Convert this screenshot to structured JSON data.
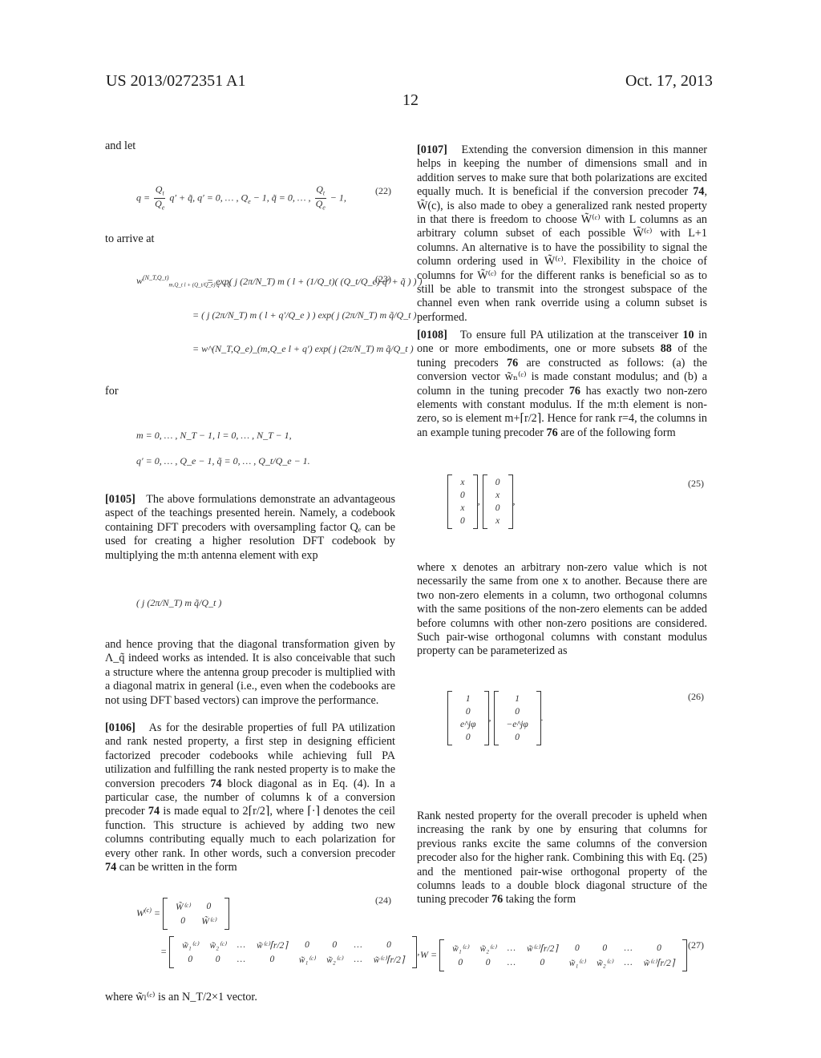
{
  "header": {
    "patent_number": "US 2013/0272351 A1",
    "page_number": "12",
    "date": "Oct. 17, 2013"
  },
  "left_column": {
    "intro_and_let": "and let",
    "eq22": {
      "number": "(22)",
      "lhs": "q =",
      "frac_num": "Q",
      "frac_num_sub": "t",
      "frac_den": "Q",
      "frac_den_sub": "e",
      "middle": "q′ + q̃, q′ = 0, … , Q",
      "middle_sub": "e",
      "middle2": " − 1, q̃ = 0, … ,",
      "tail": "− 1,"
    },
    "to_arrive_at": "to arrive at",
    "eq23": {
      "number": "(23)",
      "line1_lhs": "w",
      "line1_lhs_sup": "(N_T,Q_t)",
      "line1_lhs_sub": "m,Q_t l + (Q_t/Q_e) q′ + q̃",
      "line1_rhs": "= exp( j (2π/N_T) m ( l + (1/Q_t)( (Q_t/Q_e) q′ + q̃ ) ) )",
      "line2_rhs": "= ( j (2π/N_T) m ( l + q′/Q_e ) ) exp( j (2π/N_T) m q̃/Q_t )",
      "line3_rhs": "= w^(N_T,Q_e)_(m,Q_e l + q′) exp( j (2π/N_T) m q̃/Q_t )"
    },
    "for": "for",
    "ranges": {
      "line1": "m = 0, … , N_T − 1, l = 0, … , N_T − 1,",
      "line2": "q′ = 0, … , Q_e − 1, q̃ = 0, … , Q_t/Q_e − 1."
    },
    "p0105": {
      "num": "[0105]",
      "text": "The above formulations demonstrate an advantageous aspect of the teachings presented herein. Namely, a codebook containing DFT precoders with oversampling factor Qₑ can be used for creating a higher resolution DFT codebook by multiplying the m:th antenna element with exp",
      "inline_eq": "( j (2π/N_T) m q̃/Q_t )",
      "continuation": "and hence proving that the diagonal transformation given by Λ_q̃ indeed works as intended. It is also conceivable that such a structure where the antenna group precoder is multiplied with a diagonal matrix in general (i.e., even when the codebooks are not using DFT based vectors) can improve the performance."
    },
    "p0106": {
      "num": "[0106]",
      "text_a": "As for the desirable properties of full PA utilization and rank nested property, a first step in designing efficient factorized precoder codebooks while achieving full PA utilization and fulfilling the rank nested property is to make the conversion precoders ",
      "ref1": "74",
      "text_b": " block diagonal as in Eq. (4). In a particular case, the number of columns k of a conversion precoder ",
      "ref2": "74",
      "text_c": " is made equal to 2⌈r/2⌉, where ⌈·⌉ denotes the ceil function. This structure is achieved by adding two new columns contributing equally much to each polarization for every other rank. In other words, such a conversion precoder ",
      "ref3": "74",
      "text_d": " can be written in the form"
    },
    "eq24": {
      "number": "(24)",
      "lhs": "W",
      "lhs_sup": "(c)",
      "block_matrix": [
        [
          "W̃⁽ᶜ⁾",
          "0"
        ],
        [
          "0",
          "W̃⁽ᶜ⁾"
        ]
      ],
      "expanded_matrix": [
        [
          "w̃₁⁽ᶜ⁾",
          "w̃₂⁽ᶜ⁾",
          "…",
          "w̃⁽ᶜ⁾⌈r/2⌉",
          "0",
          "0",
          "…",
          "0"
        ],
        [
          "0",
          "0",
          "…",
          "0",
          "w̃₁⁽ᶜ⁾",
          "w̃₂⁽ᶜ⁾",
          "…",
          "w̃⁽ᶜ⁾⌈r/2⌉"
        ]
      ]
    },
    "closing": "where w̃ₗ⁽ᶜ⁾ is an N_T/2×1 vector."
  },
  "right_column": {
    "p0107": {
      "num": "[0107]",
      "text_a": "Extending the conversion dimension in this manner helps in keeping the number of dimensions small and in addition serves to make sure that both polarizations are excited equally much. It is beneficial if the conversion precoder ",
      "ref1": "74",
      "text_b": ", W̃(c), is also made to obey a generalized rank nested property in that there is freedom to choose W̃⁽ᶜ⁾ with L columns as an arbitrary column subset of each possible W̃⁽ᶜ⁾ with L+1 columns. An alternative is to have the possibility to signal the column ordering used in W̃⁽ᶜ⁾. Flexibility in the choice of columns for W̃⁽ᶜ⁾ for the different ranks is beneficial so as to still be able to transmit into the strongest subspace of the channel even when rank override using a column subset is performed."
    },
    "p0108": {
      "num": "[0108]",
      "text_a": "To ensure full PA utilization at the transceiver ",
      "ref1": "10",
      "text_b": " in one or more embodiments, one or more subsets ",
      "ref2": "88",
      "text_c": " of the tuning precoders ",
      "ref3": "76",
      "text_d": " are constructed as follows: (a) the conversion vector w̃ₙ⁽ᶜ⁾ is made constant modulus; and (b) a column in the tuning precoder ",
      "ref4": "76",
      "text_e": " has exactly two non-zero elements with constant modulus. If the m:th element is non-zero, so is element m+⌈r/2⌉. Hence for rank r=4, the columns in an example tuning precoder ",
      "ref5": "76",
      "text_f": " are of the following form"
    },
    "eq25": {
      "number": "(25)",
      "col1": [
        "x",
        "0",
        "x",
        "0"
      ],
      "col2": [
        "0",
        "x",
        "0",
        "x"
      ]
    },
    "after25": "where x denotes an arbitrary non-zero value which is not necessarily the same from one x to another. Because there are two non-zero elements in a column, two orthogonal columns with the same positions of the non-zero elements can be added before columns with other non-zero positions are considered. Such pair-wise orthogonal columns with constant modulus property can be parameterized as",
    "eq26": {
      "number": "(26)",
      "col1": [
        "1",
        "0",
        "e^jφ",
        "0"
      ],
      "col2": [
        "1",
        "0",
        "−e^jφ",
        "0"
      ]
    },
    "after26_a": "Rank nested property for the overall precoder is upheld when increasing the rank by one by ensuring that columns for previous ranks excite the same columns of the conversion precoder also for the higher rank. Combining this with Eq. (25) and the mentioned pair-wise orthogonal property of the columns leads to a double block diagonal structure of the tuning precoder ",
    "after26_ref": "76",
    "after26_b": " taking the form",
    "eq27": {
      "number": "(27)",
      "lhs": "W =",
      "matrix": [
        [
          "w̃₁⁽ᶜ⁾",
          "w̃₂⁽ᶜ⁾",
          "…",
          "w̃⁽ᶜ⁾⌈r/2⌉",
          "0",
          "0",
          "…",
          "0"
        ],
        [
          "0",
          "0",
          "…",
          "0",
          "w̃₁⁽ᶜ⁾",
          "w̃₂⁽ᶜ⁾",
          "…",
          "w̃⁽ᶜ⁾⌈r/2⌉"
        ]
      ]
    }
  }
}
